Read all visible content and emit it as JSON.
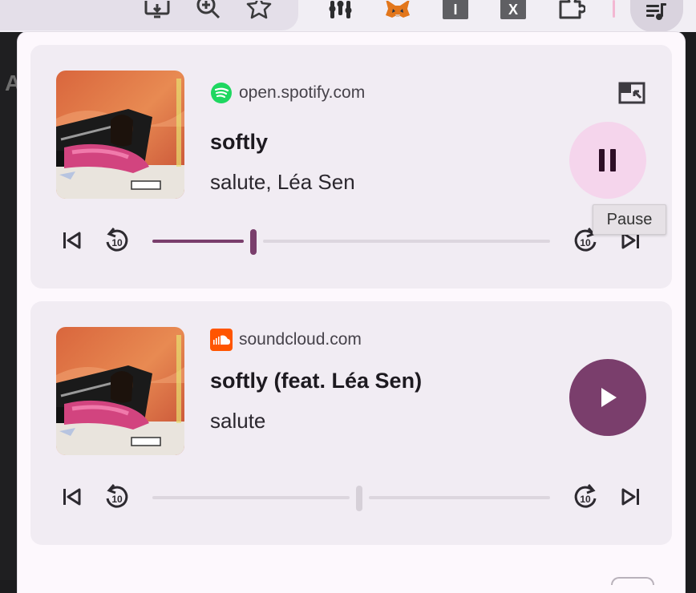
{
  "toolbar": {
    "extensions": [
      {
        "name": "cast-icon"
      },
      {
        "name": "zoom-icon"
      },
      {
        "name": "bookmark-star-icon"
      },
      {
        "name": "equalizer-extension-icon"
      },
      {
        "name": "metamask-fox-icon"
      },
      {
        "tile_label": "I"
      },
      {
        "tile_label": "X"
      },
      {
        "name": "extensions-puzzle-icon"
      }
    ],
    "media_button_icon": "queue-music-icon",
    "left_strip_letter": "A"
  },
  "colors": {
    "accent": "#7a3e6c",
    "pause_bg": "#f5d5ec",
    "card_bg": "#f1ecf3",
    "panel_bg": "#fdf8fd",
    "spotify_green": "#1ed760",
    "soundcloud_orange": "#ff5500"
  },
  "sessions": [
    {
      "origin": "open.spotify.com",
      "origin_icon": "spotify-icon",
      "title": "softly",
      "artist": "salute, Léa Sen",
      "state": "playing",
      "progress": 0.25,
      "tooltip": "Pause",
      "has_pip": true
    },
    {
      "origin": "soundcloud.com",
      "origin_icon": "soundcloud-icon",
      "title": "softly (feat. Léa Sen)",
      "artist": "salute",
      "state": "paused",
      "progress": 0.52,
      "has_pip": false
    }
  ],
  "controls": {
    "previous": "skip-previous-icon",
    "replay10": "replay-10-icon",
    "forward10": "forward-10-icon",
    "next": "skip-next-icon"
  }
}
